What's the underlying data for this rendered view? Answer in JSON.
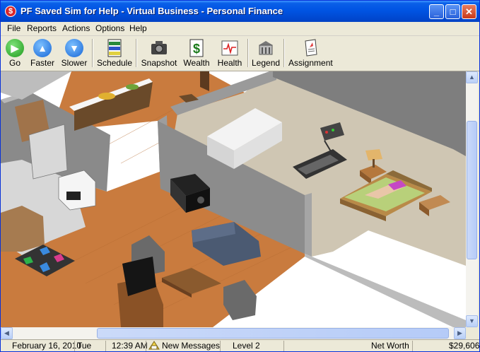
{
  "window": {
    "title": "PF Saved Sim for Help - Virtual Business - Personal Finance",
    "app_icon_letter": "$"
  },
  "menu": [
    "File",
    "Reports",
    "Actions",
    "Options",
    "Help"
  ],
  "toolbar": {
    "go": "Go",
    "faster": "Faster",
    "slower": "Slower",
    "schedule": "Schedule",
    "snapshot": "Snapshot",
    "wealth": "Wealth",
    "health": "Health",
    "legend": "Legend",
    "assignment": "Assignment"
  },
  "status": {
    "date": "February 16, 2010",
    "day": "Tue",
    "time": "12:39 AM",
    "messages": "New Messages",
    "level": "Level 2",
    "net_worth_label": "Net Worth",
    "net_worth_value": "$29,606"
  },
  "colors": {
    "titlebar": "#0054e3",
    "floor_wood": "#c97b3e",
    "wall_gray": "#8c8c8c"
  }
}
